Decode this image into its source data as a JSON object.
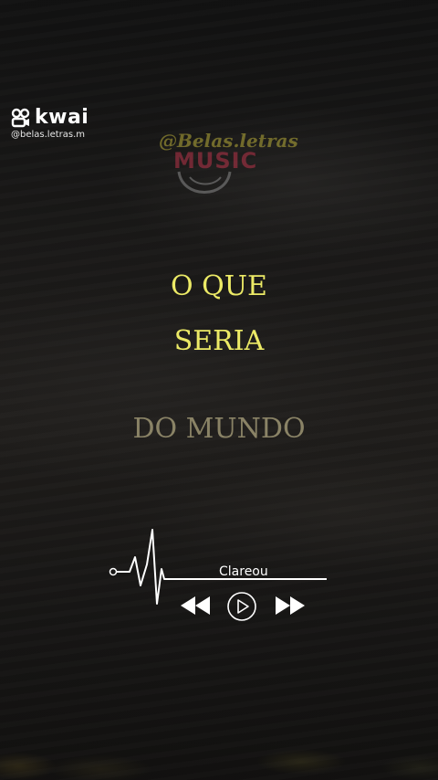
{
  "brand": {
    "name": "kwai",
    "username": "@belas.letras.m"
  },
  "watermark": {
    "script": "@Belas.letras",
    "label": "MUSIC"
  },
  "lyrics": [
    "O QUE",
    "SERIA",
    "DO MUNDO"
  ],
  "player": {
    "song_title": "Clareou"
  },
  "icons": {
    "logo": "kwai-logo-icon",
    "rewind": "rewind-icon",
    "play": "play-icon",
    "forward": "fast-forward-icon",
    "waveform": "heartbeat-waveform-icon"
  },
  "colors": {
    "lyric_active": "#ecea66",
    "lyric_dim": "#8a8366"
  }
}
